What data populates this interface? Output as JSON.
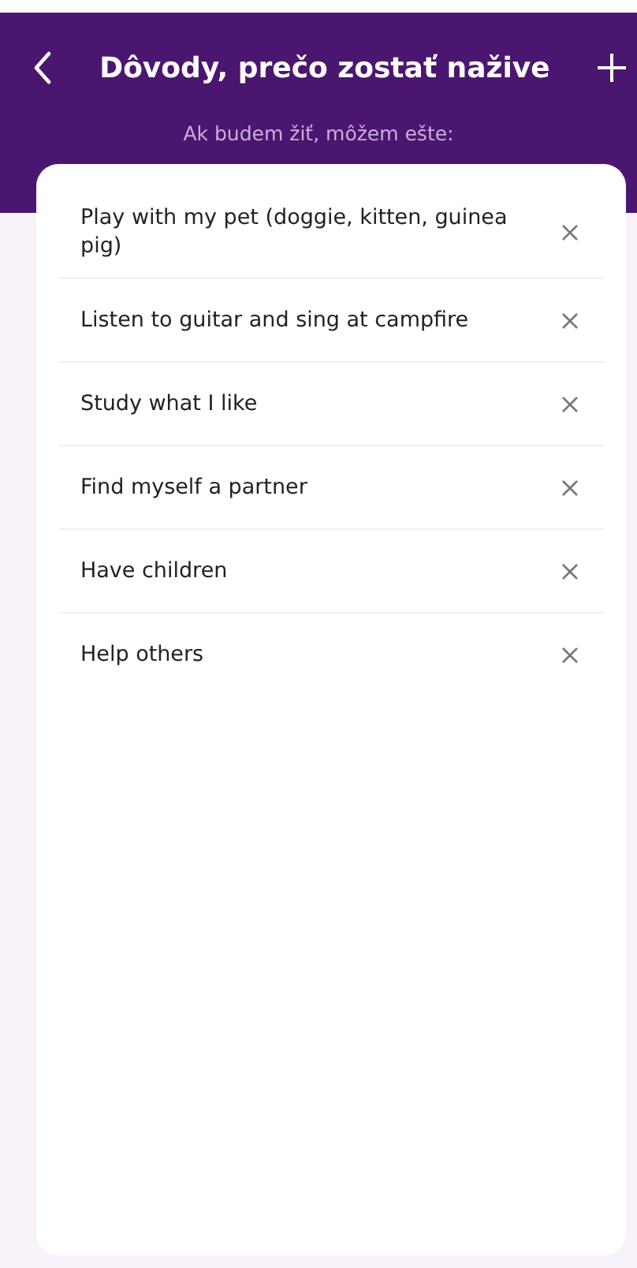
{
  "header": {
    "title": "Dôvody, prečo zostať nažive",
    "subtitle": "Ak budem žiť, môžem ešte:"
  },
  "reasons": [
    {
      "text": "Play with my pet (doggie, kitten, guinea pig)"
    },
    {
      "text": "Listen to guitar and sing at campfire"
    },
    {
      "text": "Study what I like"
    },
    {
      "text": "Find myself a partner"
    },
    {
      "text": "Have children"
    },
    {
      "text": "Help others"
    }
  ]
}
